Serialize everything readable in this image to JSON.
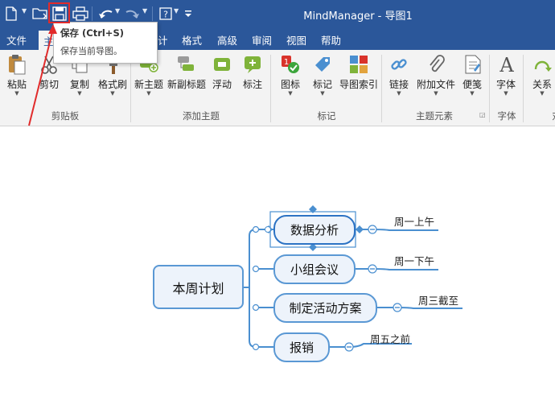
{
  "app": {
    "title": "MindManager - 导图1"
  },
  "quick_access": {
    "items": [
      "new-icon",
      "open-icon",
      "save-icon",
      "print-icon",
      "undo-icon",
      "redo-icon",
      "help-icon",
      "customize-icon"
    ]
  },
  "tooltip": {
    "title": "保存 (Ctrl+S)",
    "description": "保存当前导图。"
  },
  "tabs": {
    "file": "文件",
    "home": "主",
    "design": "计",
    "format": "格式",
    "advanced": "高级",
    "review": "审阅",
    "view": "视图",
    "help": "帮助"
  },
  "ribbon": {
    "clipboard": {
      "paste": "粘贴",
      "cut": "剪切",
      "copy": "复制",
      "format_painter": "格式刷",
      "group": "剪贴板"
    },
    "add_topic": {
      "new_topic": "新主题",
      "new_subtopic": "新副标题",
      "floating": "浮动",
      "callout": "标注",
      "group": "添加主题"
    },
    "markers": {
      "icon": "图标",
      "tag": "标记",
      "map_index": "导图索引",
      "group": "标记"
    },
    "topic_elements": {
      "link": "链接",
      "attachment": "附加文件",
      "note": "便笺",
      "group": "主题元素"
    },
    "font": {
      "font": "字体",
      "group": "字体"
    },
    "relation": {
      "relation": "关系",
      "group": "对"
    }
  },
  "map": {
    "central": "本周计划",
    "topics": [
      {
        "label": "数据分析",
        "note": "周一上午"
      },
      {
        "label": "小组会议",
        "note": "周一下午"
      },
      {
        "label": "制定活动方案",
        "note": "周三截至"
      },
      {
        "label": "报销",
        "note": "周五之前"
      }
    ]
  },
  "colors": {
    "titlebar": "#2b579a",
    "node_border": "#4a8fd0",
    "node_fill": "#edf3fb",
    "highlight": "#e12b2b"
  }
}
